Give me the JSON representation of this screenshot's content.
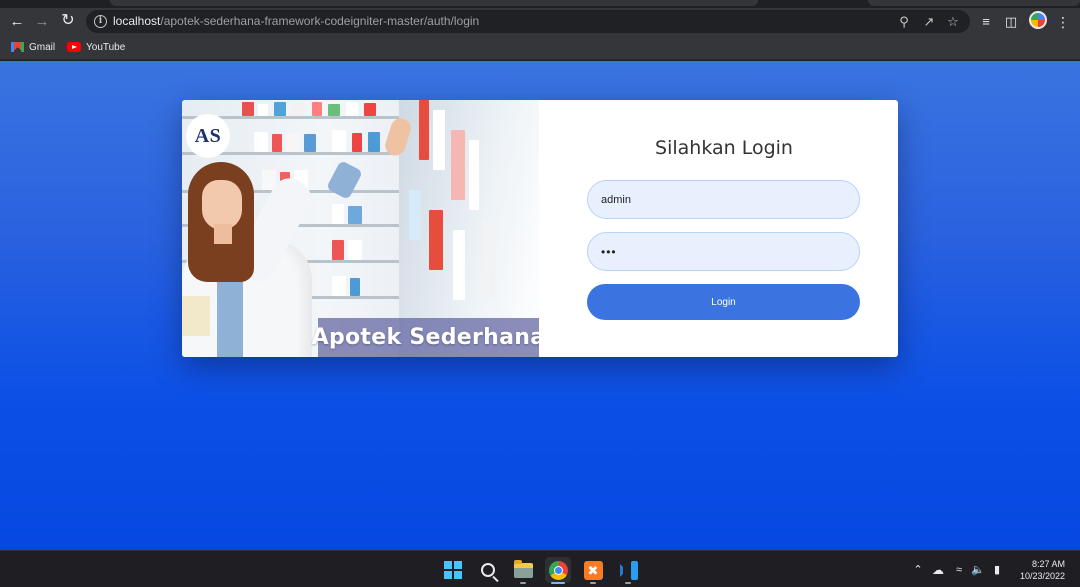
{
  "browser": {
    "url_host": "localhost",
    "url_path": "/apotek-sederhana-framework-codeigniter-master/auth/login",
    "bookmarks": [
      {
        "label": "Gmail",
        "icon": "gmail-icon"
      },
      {
        "label": "YouTube",
        "icon": "youtube-icon"
      }
    ],
    "toolbar_icons": [
      "back-icon",
      "forward-icon",
      "reload-icon",
      "info-icon",
      "key-icon",
      "share-icon",
      "star-icon",
      "reading-list-icon",
      "side-panel-icon",
      "profile-avatar",
      "menu-icon"
    ]
  },
  "brand": {
    "logo_text": "AS",
    "banner_title": "Apotek Sederhana"
  },
  "login": {
    "title": "Silahkan Login",
    "username_value": "admin",
    "password_value": "•••",
    "button_label": "Login"
  },
  "colors": {
    "background_top": "#3a74e0",
    "background_bottom": "#0648e1",
    "button": "#3b74e0",
    "field_bg": "#e8f0fe",
    "field_border": "#b8d3f4"
  },
  "taskbar": {
    "apps": [
      "windows-start-icon",
      "search-icon",
      "file-explorer-icon",
      "chrome-icon",
      "xampp-icon",
      "vscode-icon"
    ],
    "active_app": "chrome-icon",
    "time": "8:27 AM",
    "date": "10/23/2022"
  }
}
